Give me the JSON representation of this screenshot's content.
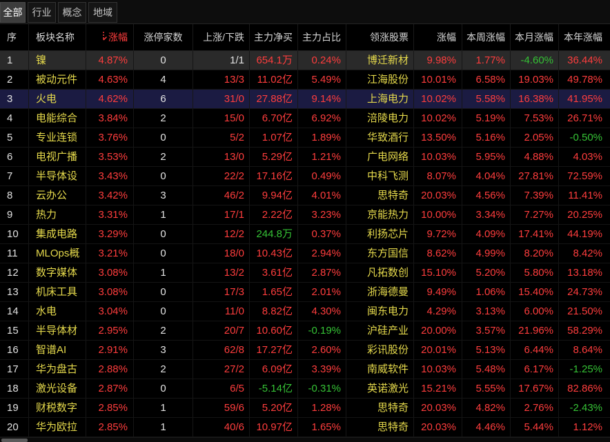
{
  "tabs": [
    {
      "label": "全部",
      "active": true
    },
    {
      "label": "行业",
      "active": false
    },
    {
      "label": "概念",
      "active": false
    },
    {
      "label": "地域",
      "active": false
    }
  ],
  "columns": [
    "序",
    "板块名称",
    "涨幅",
    "涨停家数",
    "上涨/下跌",
    "主力净买",
    "主力占比",
    "领涨股票",
    "涨幅",
    "本周涨幅",
    "本月涨幅",
    "本年涨幅"
  ],
  "sort": {
    "column": "涨幅",
    "direction": "descending",
    "icon": "sort-descending-icon"
  },
  "colors": {
    "up": "#ff3d3d",
    "down": "#35c235",
    "flat": "#e2e2e2",
    "neutral": "#e2e2e2",
    "name": "#e6da4c"
  },
  "rows": [
    {
      "idx": "1",
      "name": "镍",
      "chg": "4.87%",
      "limit_up": "0",
      "up_down": "1/1",
      "net_buy": "654.1万",
      "net_ratio": "0.24%",
      "leader": "博迁新材",
      "leader_chg": "9.98%",
      "week_chg": "1.77%",
      "month_chg": "-4.60%",
      "year_chg": "36.44%",
      "hovered": true
    },
    {
      "idx": "2",
      "name": "被动元件",
      "chg": "4.63%",
      "limit_up": "4",
      "up_down": "13/3",
      "net_buy": "11.02亿",
      "net_ratio": "5.49%",
      "leader": "江海股份",
      "leader_chg": "10.01%",
      "week_chg": "6.58%",
      "month_chg": "19.03%",
      "year_chg": "49.78%"
    },
    {
      "idx": "3",
      "name": "火电",
      "chg": "4.62%",
      "limit_up": "6",
      "up_down": "31/0",
      "net_buy": "27.88亿",
      "net_ratio": "9.14%",
      "leader": "上海电力",
      "leader_chg": "10.02%",
      "week_chg": "5.58%",
      "month_chg": "16.38%",
      "year_chg": "41.95%",
      "selected": true
    },
    {
      "idx": "4",
      "name": "电能综合",
      "chg": "3.84%",
      "limit_up": "2",
      "up_down": "15/0",
      "net_buy": "6.70亿",
      "net_ratio": "6.92%",
      "leader": "涪陵电力",
      "leader_chg": "10.02%",
      "week_chg": "5.19%",
      "month_chg": "7.53%",
      "year_chg": "26.71%"
    },
    {
      "idx": "5",
      "name": "专业连锁",
      "chg": "3.76%",
      "limit_up": "0",
      "up_down": "5/2",
      "net_buy": "1.07亿",
      "net_ratio": "1.89%",
      "leader": "华致酒行",
      "leader_chg": "13.50%",
      "week_chg": "5.16%",
      "month_chg": "2.05%",
      "year_chg": "-0.50%"
    },
    {
      "idx": "6",
      "name": "电视广播",
      "chg": "3.53%",
      "limit_up": "2",
      "up_down": "13/0",
      "net_buy": "5.29亿",
      "net_ratio": "1.21%",
      "leader": "广电网络",
      "leader_chg": "10.03%",
      "week_chg": "5.95%",
      "month_chg": "4.88%",
      "year_chg": "4.03%"
    },
    {
      "idx": "7",
      "name": "半导体设",
      "chg": "3.43%",
      "limit_up": "0",
      "up_down": "22/2",
      "net_buy": "17.16亿",
      "net_ratio": "0.49%",
      "leader": "中科飞测",
      "leader_chg": "8.07%",
      "week_chg": "4.04%",
      "month_chg": "27.81%",
      "year_chg": "72.59%"
    },
    {
      "idx": "8",
      "name": "云办公",
      "chg": "3.42%",
      "limit_up": "3",
      "up_down": "46/2",
      "net_buy": "9.94亿",
      "net_ratio": "4.01%",
      "leader": "思特奇",
      "leader_chg": "20.03%",
      "week_chg": "4.56%",
      "month_chg": "7.39%",
      "year_chg": "11.41%"
    },
    {
      "idx": "9",
      "name": "热力",
      "chg": "3.31%",
      "limit_up": "1",
      "up_down": "17/1",
      "net_buy": "2.22亿",
      "net_ratio": "3.23%",
      "leader": "京能热力",
      "leader_chg": "10.00%",
      "week_chg": "3.34%",
      "month_chg": "7.27%",
      "year_chg": "20.25%"
    },
    {
      "idx": "10",
      "name": "集成电路",
      "chg": "3.29%",
      "limit_up": "0",
      "up_down": "12/2",
      "net_buy": "244.8万",
      "net_ratio": "0.37%",
      "leader": "利扬芯片",
      "leader_chg": "9.72%",
      "week_chg": "4.09%",
      "month_chg": "17.41%",
      "year_chg": "44.19%",
      "tones": {
        "net_buy": "down"
      }
    },
    {
      "idx": "11",
      "name": "MLOps概",
      "chg": "3.21%",
      "limit_up": "0",
      "up_down": "18/0",
      "net_buy": "10.43亿",
      "net_ratio": "2.94%",
      "leader": "东方国信",
      "leader_chg": "8.62%",
      "week_chg": "4.99%",
      "month_chg": "8.20%",
      "year_chg": "8.42%"
    },
    {
      "idx": "12",
      "name": "数字媒体",
      "chg": "3.08%",
      "limit_up": "1",
      "up_down": "13/2",
      "net_buy": "3.61亿",
      "net_ratio": "2.87%",
      "leader": "凡拓数创",
      "leader_chg": "15.10%",
      "week_chg": "5.20%",
      "month_chg": "5.80%",
      "year_chg": "13.18%"
    },
    {
      "idx": "13",
      "name": "机床工具",
      "chg": "3.08%",
      "limit_up": "0",
      "up_down": "17/3",
      "net_buy": "1.65亿",
      "net_ratio": "2.01%",
      "leader": "浙海德曼",
      "leader_chg": "9.49%",
      "week_chg": "1.06%",
      "month_chg": "15.40%",
      "year_chg": "24.73%"
    },
    {
      "idx": "14",
      "name": "水电",
      "chg": "3.04%",
      "limit_up": "0",
      "up_down": "11/0",
      "net_buy": "8.82亿",
      "net_ratio": "4.30%",
      "leader": "闽东电力",
      "leader_chg": "4.29%",
      "week_chg": "3.13%",
      "month_chg": "6.00%",
      "year_chg": "21.50%"
    },
    {
      "idx": "15",
      "name": "半导体材",
      "chg": "2.95%",
      "limit_up": "2",
      "up_down": "20/7",
      "net_buy": "10.60亿",
      "net_ratio": "-0.19%",
      "leader": "沪硅产业",
      "leader_chg": "20.00%",
      "week_chg": "3.57%",
      "month_chg": "21.96%",
      "year_chg": "58.29%"
    },
    {
      "idx": "16",
      "name": "智谱AI",
      "chg": "2.91%",
      "limit_up": "3",
      "up_down": "62/8",
      "net_buy": "17.27亿",
      "net_ratio": "2.60%",
      "leader": "彩讯股份",
      "leader_chg": "20.01%",
      "week_chg": "5.13%",
      "month_chg": "6.44%",
      "year_chg": "8.64%"
    },
    {
      "idx": "17",
      "name": "华为盘古",
      "chg": "2.88%",
      "limit_up": "2",
      "up_down": "27/2",
      "net_buy": "6.09亿",
      "net_ratio": "3.39%",
      "leader": "南威软件",
      "leader_chg": "10.03%",
      "week_chg": "5.48%",
      "month_chg": "6.17%",
      "year_chg": "-1.25%"
    },
    {
      "idx": "18",
      "name": "激光设备",
      "chg": "2.87%",
      "limit_up": "0",
      "up_down": "6/5",
      "net_buy": "-5.14亿",
      "net_ratio": "-0.31%",
      "leader": "英诺激光",
      "leader_chg": "15.21%",
      "week_chg": "5.55%",
      "month_chg": "17.67%",
      "year_chg": "82.86%"
    },
    {
      "idx": "19",
      "name": "财税数字",
      "chg": "2.85%",
      "limit_up": "1",
      "up_down": "59/6",
      "net_buy": "5.20亿",
      "net_ratio": "1.28%",
      "leader": "思特奇",
      "leader_chg": "20.03%",
      "week_chg": "4.82%",
      "month_chg": "2.76%",
      "year_chg": "-2.43%"
    },
    {
      "idx": "20",
      "name": "华为欧拉",
      "chg": "2.85%",
      "limit_up": "1",
      "up_down": "40/6",
      "net_buy": "10.97亿",
      "net_ratio": "1.65%",
      "leader": "思特奇",
      "leader_chg": "20.03%",
      "week_chg": "4.46%",
      "month_chg": "5.44%",
      "year_chg": "1.12%"
    }
  ]
}
